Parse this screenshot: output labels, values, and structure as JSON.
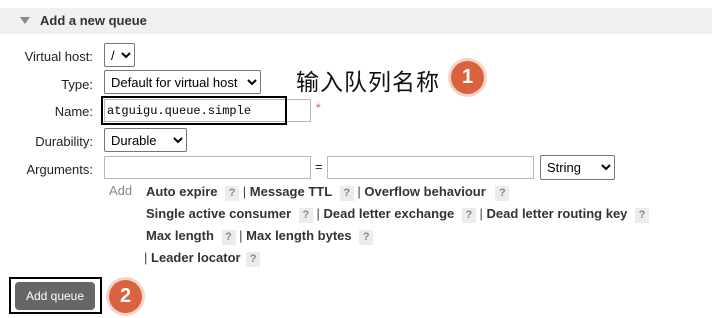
{
  "section": {
    "title": "Add a new queue"
  },
  "form": {
    "virtual_host": {
      "label": "Virtual host:",
      "value": "/"
    },
    "type": {
      "label": "Type:",
      "value": "Default for virtual host"
    },
    "name": {
      "label": "Name:",
      "value": "atguigu.queue.simple",
      "required_mark": "*"
    },
    "durability": {
      "label": "Durability:",
      "value": "Durable"
    },
    "arguments": {
      "label": "Arguments:",
      "key": "",
      "value": "",
      "equals": "=",
      "type_value": "String"
    }
  },
  "argument_hints": {
    "add_label": "Add",
    "help_mark": "?",
    "separator": "|",
    "items": [
      "Auto expire",
      "Message TTL",
      "Overflow behaviour",
      "Single active consumer",
      "Dead letter exchange",
      "Dead letter routing key",
      "Max length",
      "Max length bytes",
      "Leader locator"
    ]
  },
  "add_button": {
    "label": "Add queue"
  },
  "annotations": {
    "text": "输入队列名称",
    "badge1": "1",
    "badge2": "2",
    "accent_color": "#d9623f"
  }
}
